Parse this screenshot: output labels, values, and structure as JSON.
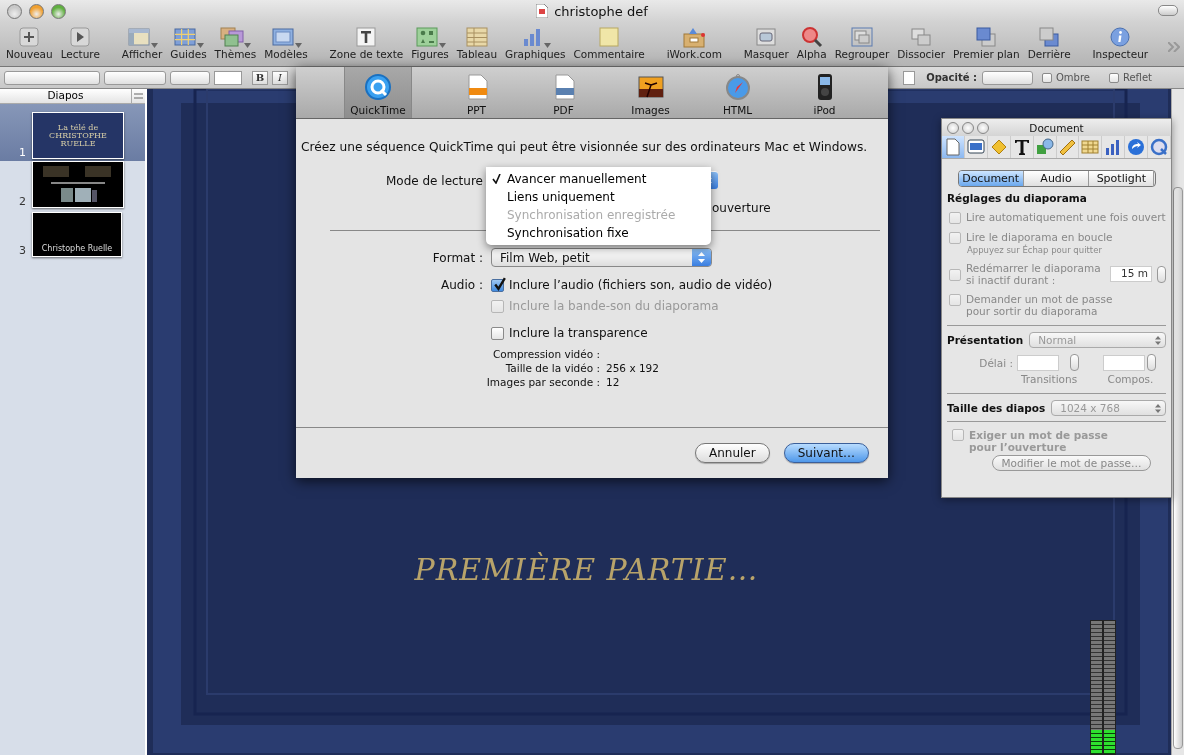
{
  "window": {
    "title": "christophe def"
  },
  "toolbar": {
    "groups": [
      [
        {
          "label": "Nouveau",
          "has_menu": false
        },
        {
          "label": "Lecture",
          "has_menu": false
        }
      ],
      [
        {
          "label": "Afficher",
          "has_menu": true
        },
        {
          "label": "Guides",
          "has_menu": true
        },
        {
          "label": "Thèmes",
          "has_menu": true
        },
        {
          "label": "Modèles",
          "has_menu": true
        }
      ],
      [
        {
          "label": "Zone de texte",
          "has_menu": false
        },
        {
          "label": "Figures",
          "has_menu": true
        },
        {
          "label": "Tableau",
          "has_menu": false
        },
        {
          "label": "Graphiques",
          "has_menu": true
        },
        {
          "label": "Commentaire",
          "has_menu": false
        }
      ],
      [
        {
          "label": "iWork.com",
          "has_menu": false
        }
      ],
      [
        {
          "label": "Masquer",
          "has_menu": false
        },
        {
          "label": "Alpha",
          "has_menu": false
        },
        {
          "label": "Regrouper",
          "has_menu": false
        },
        {
          "label": "Dissocier",
          "has_menu": false
        },
        {
          "label": "Premier plan",
          "has_menu": false
        },
        {
          "label": "Derrière",
          "has_menu": false
        }
      ],
      [
        {
          "label": "Inspecteur",
          "has_menu": false
        }
      ]
    ]
  },
  "format_bar": {
    "bold": "B",
    "italic": "I",
    "opacity_label": "Opacité :",
    "checkboxes": [
      {
        "label": "Ombre",
        "checked": false
      },
      {
        "label": "Reflet",
        "checked": false
      }
    ]
  },
  "sidebar": {
    "title": "Diapos",
    "slides": [
      {
        "number": "1",
        "selected": true,
        "kind": "title",
        "lines": [
          "La télé de",
          "CHRISTOPHE",
          "RUELLE"
        ]
      },
      {
        "number": "2",
        "selected": false,
        "kind": "photos"
      },
      {
        "number": "3",
        "selected": false,
        "kind": "credit",
        "lines": [
          "Christophe Ruelle"
        ]
      }
    ]
  },
  "slide": {
    "subtitle": "PREMIÈRE PARTIE…"
  },
  "export_sheet": {
    "tabs": [
      {
        "label": "QuickTime",
        "selected": true
      },
      {
        "label": "PPT",
        "selected": false
      },
      {
        "label": "PDF",
        "selected": false
      },
      {
        "label": "Images",
        "selected": false
      },
      {
        "label": "HTML",
        "selected": false
      },
      {
        "label": "iPod",
        "selected": false
      }
    ],
    "description": "Créez une séquence QuickTime qui peut être visionnée sur des ordinateurs Mac et Windows.",
    "playback_label": "Mode de lecture",
    "option_tail": "ouverture",
    "format_label": "Format :",
    "format_value": "Film Web, petit",
    "audio_label": "Audio :",
    "options": [
      {
        "label": "Inclure l’audio (fichiers son, audio de vidéo)",
        "checked": true,
        "disabled": false
      },
      {
        "label": "Inclure la bande-son du diaporama",
        "checked": false,
        "disabled": true
      },
      {
        "label": "Inclure la transparence",
        "checked": false,
        "disabled": false
      }
    ],
    "info": [
      {
        "label": "Compression vidéo :"
      },
      {
        "label": "Taille de la vidéo :",
        "value": "256 x 192"
      },
      {
        "label": "Images par seconde :",
        "value": "12"
      }
    ],
    "buttons": [
      {
        "label": "Annuler",
        "default": false
      },
      {
        "label": "Suivant…",
        "default": true
      }
    ]
  },
  "playback_menu": {
    "items": [
      {
        "label": "Avancer manuellement",
        "selected": true,
        "disabled": false
      },
      {
        "label": "Liens uniquement",
        "selected": false,
        "disabled": false
      },
      {
        "label": "Synchronisation enregistrée",
        "selected": false,
        "disabled": true
      },
      {
        "label": "Synchronisation fixe",
        "selected": false,
        "disabled": false
      }
    ]
  },
  "inspector": {
    "title": "Document",
    "tools": [
      {
        "selected": true
      },
      {
        "selected": false
      },
      {
        "selected": false
      },
      {
        "selected": false
      },
      {
        "selected": false
      },
      {
        "selected": false
      },
      {
        "selected": false
      },
      {
        "selected": false
      },
      {
        "selected": false
      },
      {
        "selected": false
      }
    ],
    "segments": [
      {
        "label": "Document",
        "selected": true
      },
      {
        "label": "Audio",
        "selected": false
      },
      {
        "label": "Spotlight",
        "selected": false
      }
    ],
    "section_title": "Réglages du diaporama",
    "settings": [
      {
        "label": "Lire automatiquement une fois ouvert",
        "checked": false,
        "disabled": true
      },
      {
        "label": "Lire le diaporama en boucle",
        "checked": false,
        "disabled": true,
        "hint": "Appuyez sur Échap pour quitter"
      },
      {
        "label": "Redémarrer le diaporama si inactif durant :",
        "checked": false,
        "disabled": true,
        "value": "15 m"
      },
      {
        "label": "Demander un mot de passe pour sortir du diaporama",
        "checked": false,
        "disabled": true
      }
    ],
    "presentation_label": "Présentation",
    "presentation_value": "Normal",
    "delay_label": "Délai :",
    "delay_captions": [
      "Transitions",
      "Compos."
    ],
    "slide_size_label": "Taille des diapos",
    "slide_size_value": "1024 x 768",
    "password": {
      "label": "Exiger un mot de passe pour l’ouverture",
      "checked": false,
      "disabled": true
    },
    "password_button": "Modifier le mot de passe…"
  },
  "level_meter": [
    {
      "level": 0.18
    },
    {
      "level": 0.18
    }
  ]
}
